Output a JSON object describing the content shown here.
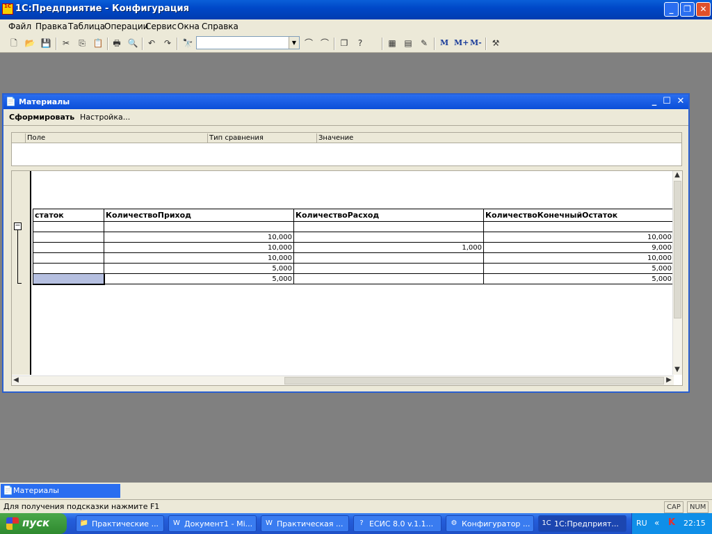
{
  "app": {
    "title": "1С:Предприятие - Конфигурация",
    "icon_label": "1С"
  },
  "menu": [
    "Файл",
    "Правка",
    "Таблица",
    "Операции",
    "Сервис",
    "Окна",
    "Справка"
  ],
  "toolbar": {
    "search_value": "",
    "m_label": "M",
    "m_plus_label": "M+",
    "m_minus_label": "M-"
  },
  "child_window": {
    "title": "Материалы",
    "generate_label": "Сформировать",
    "settings_label": "Настройка...",
    "filter_columns": [
      "Поле",
      "Тип сравнения",
      "Значение"
    ]
  },
  "report": {
    "columns": [
      "статок",
      "КоличествоПриход",
      "КоличествоРасход",
      "КоличествоКонечныйОстаток"
    ],
    "rows": [
      [
        "",
        "",
        "",
        ""
      ],
      [
        "",
        "10,000",
        "",
        "10,000"
      ],
      [
        "",
        "10,000",
        "1,000",
        "9,000"
      ],
      [
        "",
        "10,000",
        "",
        "10,000"
      ],
      [
        "",
        "5,000",
        "",
        "5,000"
      ],
      [
        "",
        "5,000",
        "",
        "5,000"
      ]
    ]
  },
  "window_tabs": {
    "materials": "Материалы"
  },
  "status": {
    "hint": "Для получения подсказки нажмите F1",
    "cap": "CAP",
    "num": "NUM"
  },
  "taskbar": {
    "start_label": "пуск",
    "tasks": [
      "Практические ...",
      "Документ1 - Mi...",
      "Практическая ...",
      "ЕСИС 8.0 v.1.1...",
      "Конфигуратор ...",
      "1С:Предприят..."
    ],
    "lang": "RU",
    "clock": "22:15"
  }
}
